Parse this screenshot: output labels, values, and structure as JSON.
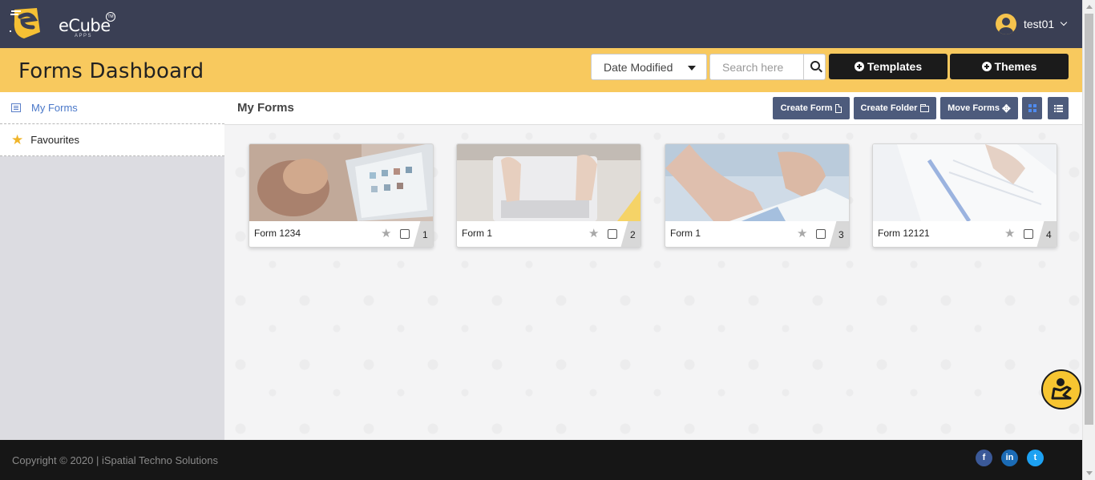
{
  "brand": {
    "name": "eCube",
    "sub": "APPS",
    "tm": "TM"
  },
  "user": {
    "name": "test01"
  },
  "header": {
    "title": "Forms Dashboard",
    "sort_value": "Date Modified",
    "search_placeholder": "Search here",
    "templates_label": "Templates",
    "themes_label": "Themes"
  },
  "sidebar": {
    "items": [
      {
        "label": "My Forms",
        "icon": "list-icon",
        "active": true
      },
      {
        "label": "Favourites",
        "icon": "star-icon"
      }
    ]
  },
  "main": {
    "title": "My Forms",
    "create_form_label": "Create Form",
    "create_folder_label": "Create Folder",
    "move_forms_label": "Move Forms"
  },
  "cards": [
    {
      "name": "Form 1234",
      "number": "1"
    },
    {
      "name": "Form 1",
      "number": "2"
    },
    {
      "name": "Form 1",
      "number": "3"
    },
    {
      "name": "Form 12121",
      "number": "4"
    }
  ],
  "footer": {
    "copyright": "Copyright © 2020 | iSpatial Techno Solutions",
    "social": [
      {
        "name": "facebook",
        "glyph": "f",
        "color": "#3b5998"
      },
      {
        "name": "linkedin",
        "glyph": "in",
        "color": "#1b6bb5"
      },
      {
        "name": "twitter",
        "glyph": "t",
        "color": "#1da1f2"
      }
    ]
  },
  "colors": {
    "topbar": "#3a3f54",
    "header": "#f8c95e",
    "accent": "#4d5b7c",
    "dark_button": "#1b1b1b"
  }
}
